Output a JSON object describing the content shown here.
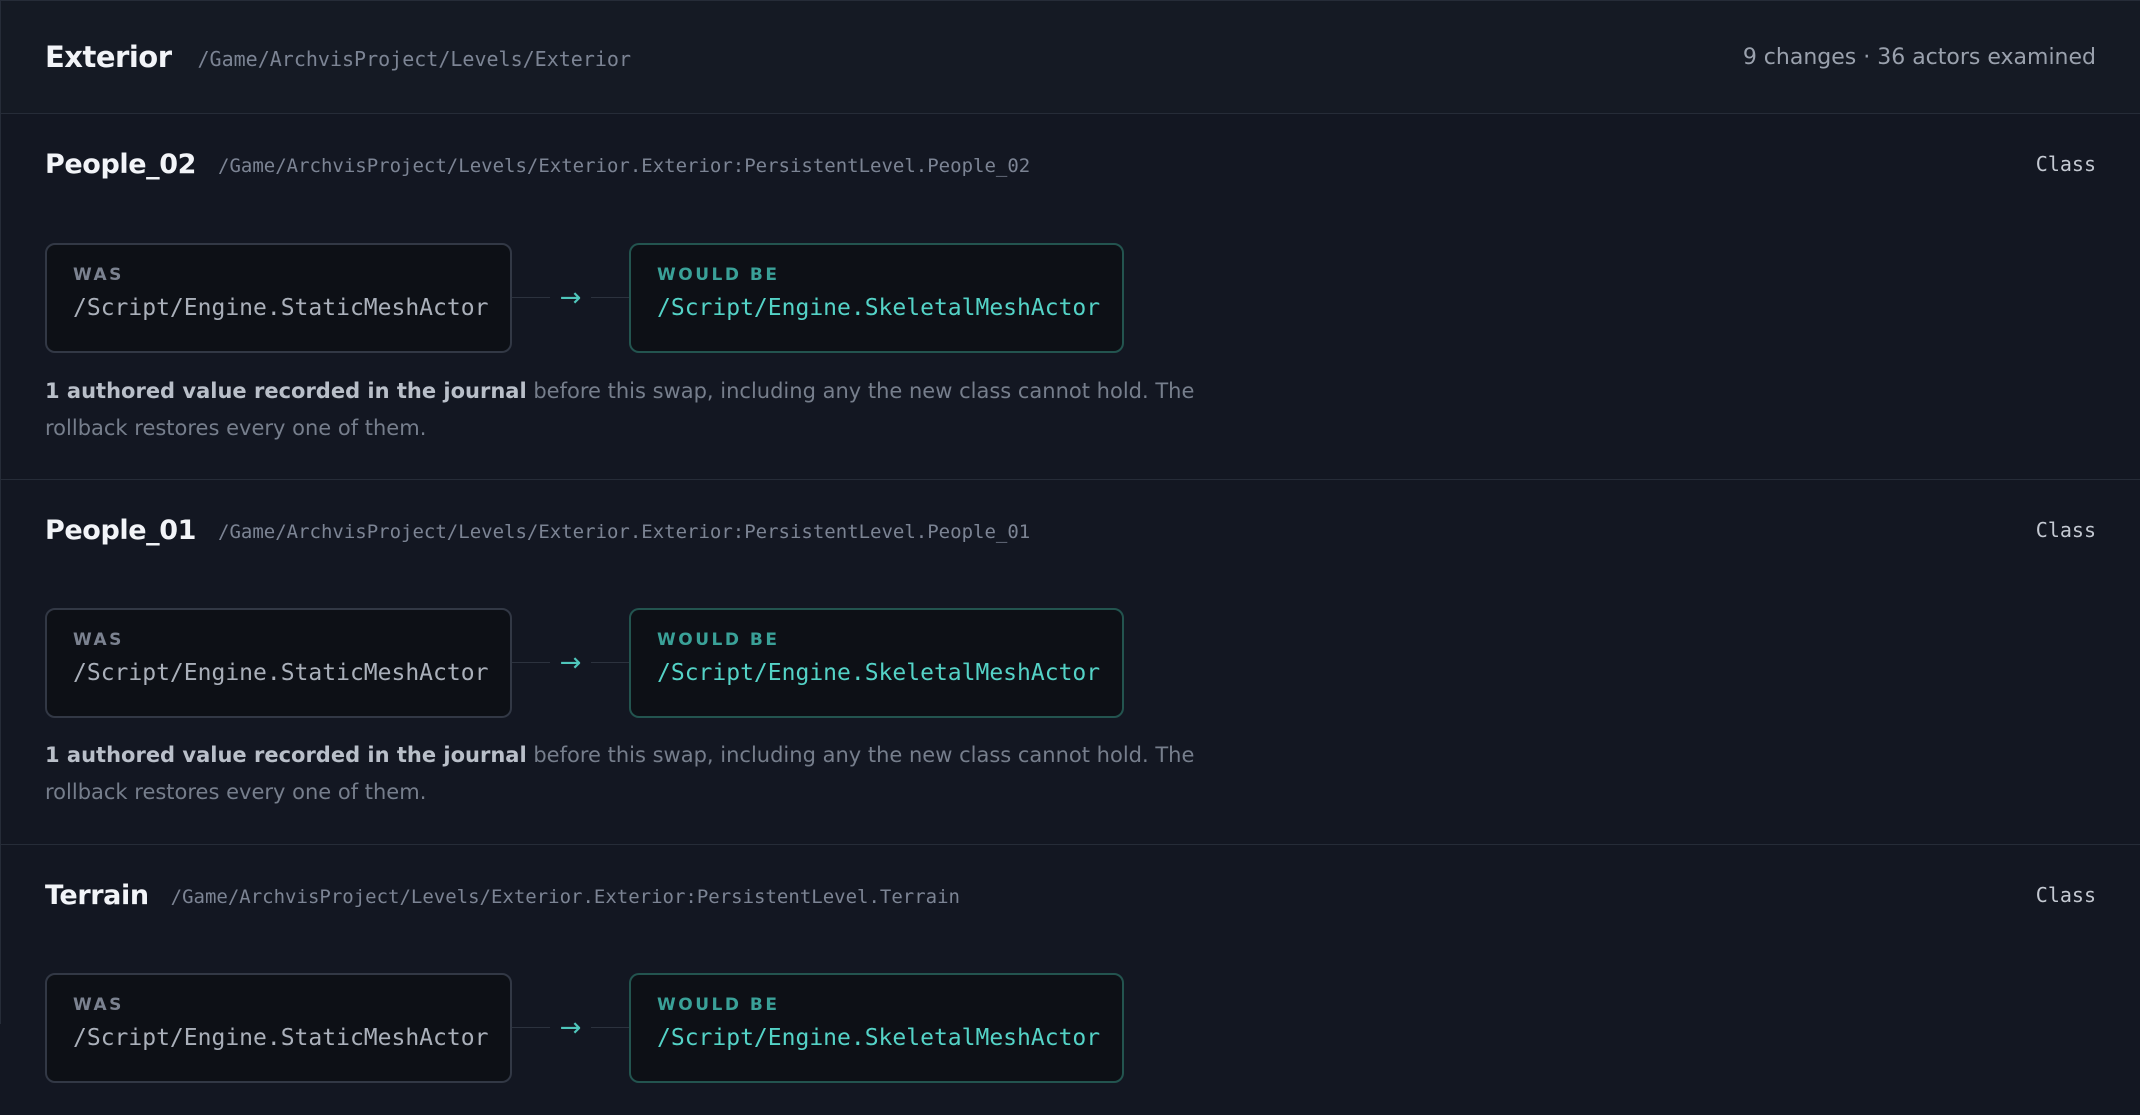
{
  "header": {
    "title": "Exterior",
    "path": "/Game/ArchvisProject/Levels/Exterior",
    "summary": "9 changes · 36 actors examined"
  },
  "labels": {
    "was": "WAS",
    "would_be": "WOULD BE",
    "arrow": "→"
  },
  "changes": [
    {
      "name": "People_02",
      "path": "/Game/ArchvisProject/Levels/Exterior.Exterior:PersistentLevel.People_02",
      "kind": "Class",
      "was": "/Script/Engine.StaticMeshActor",
      "would_be": "/Script/Engine.SkeletalMeshActor",
      "note_strong": "1 authored value recorded in the journal",
      "note_rest": " before this swap, including any the new class cannot hold. The rollback restores every one of them."
    },
    {
      "name": "People_01",
      "path": "/Game/ArchvisProject/Levels/Exterior.Exterior:PersistentLevel.People_01",
      "kind": "Class",
      "was": "/Script/Engine.StaticMeshActor",
      "would_be": "/Script/Engine.SkeletalMeshActor",
      "note_strong": "1 authored value recorded in the journal",
      "note_rest": " before this swap, including any the new class cannot hold. The rollback restores every one of them."
    },
    {
      "name": "Terrain",
      "path": "/Game/ArchvisProject/Levels/Exterior.Exterior:PersistentLevel.Terrain",
      "kind": "Class",
      "was": "/Script/Engine.StaticMeshActor",
      "would_be": "/Script/Engine.SkeletalMeshActor"
    }
  ]
}
